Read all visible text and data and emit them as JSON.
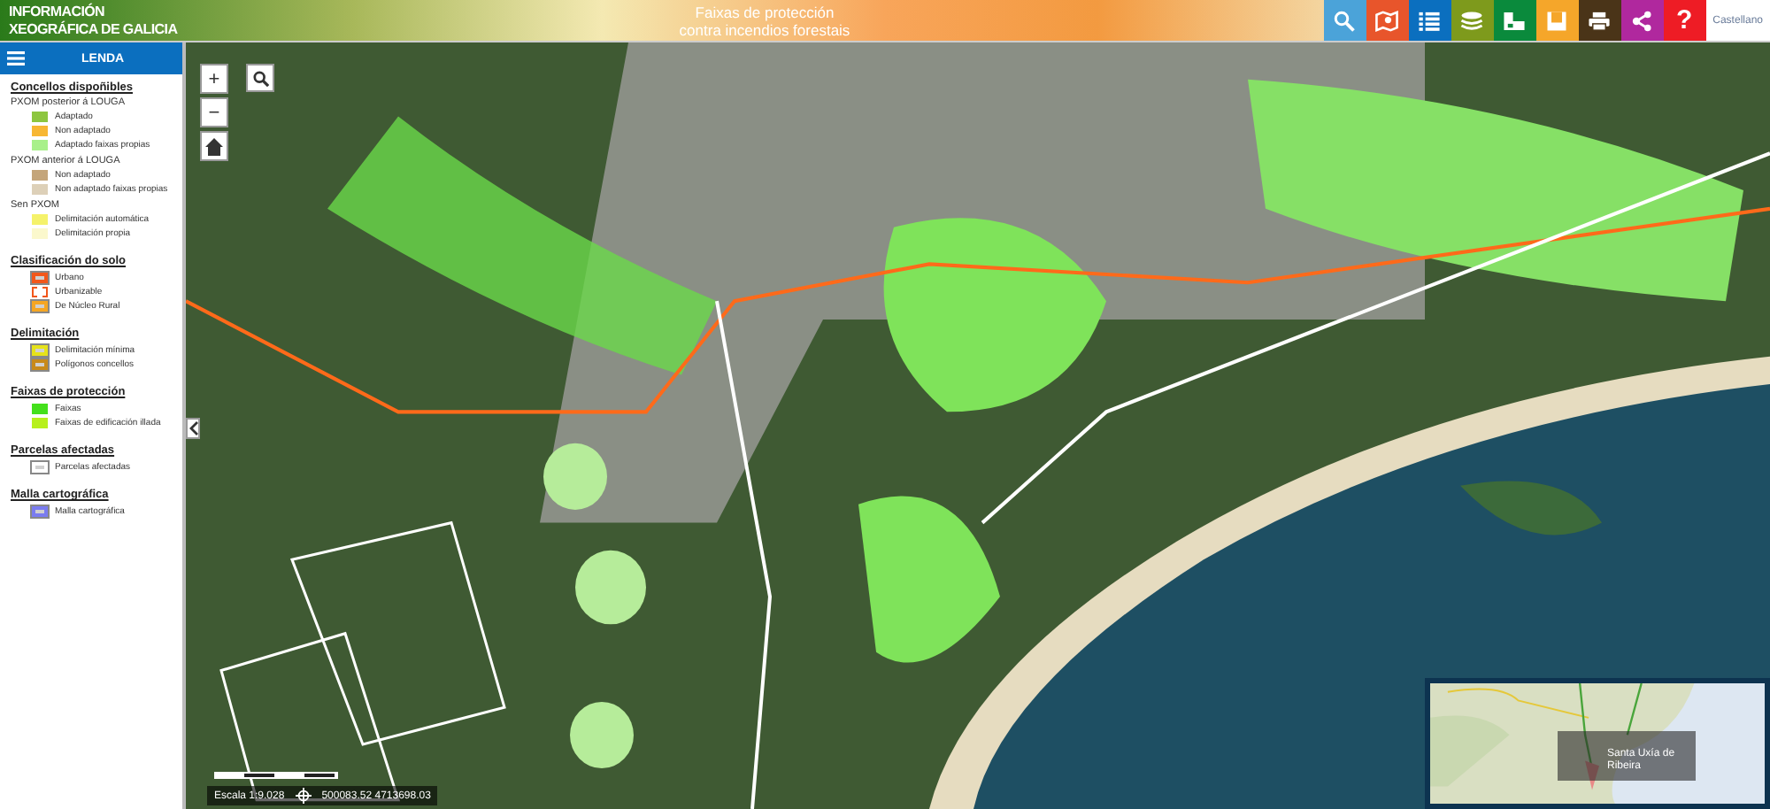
{
  "header": {
    "logo": [
      "INFORMACIÓN",
      "XEOGRÁFICA DE GALICIA"
    ],
    "title": [
      "Faixas de protección",
      "contra incendios forestais"
    ],
    "language": "Castellano"
  },
  "toolbar": [
    {
      "kind": "search",
      "color": "#4ba3d9"
    },
    {
      "kind": "map",
      "color": "#e8552b"
    },
    {
      "kind": "list",
      "color": "#0b6fbf"
    },
    {
      "kind": "layers",
      "color": "#7e9a1c"
    },
    {
      "kind": "legend",
      "color": "#0a8a3c"
    },
    {
      "kind": "save",
      "color": "#f5a62a"
    },
    {
      "kind": "print",
      "color": "#4a3418"
    },
    {
      "kind": "share",
      "color": "#b0289e"
    },
    {
      "kind": "help",
      "color": "#ee1c25",
      "label": "?"
    }
  ],
  "legend": {
    "title": "LENDA",
    "sections": [
      {
        "title": "Concellos dispoñibles",
        "groups": [
          {
            "subtitle": "PXOM posterior á LOUGA",
            "items": [
              {
                "label": "Adaptado",
                "kind": "fill",
                "color": "#8dc63f"
              },
              {
                "label": "Non adaptado",
                "kind": "fill",
                "color": "#f7b733"
              },
              {
                "label": "Adaptado faixas propias",
                "kind": "fill",
                "color": "#a8f08a"
              }
            ]
          },
          {
            "subtitle": "PXOM anterior á LOUGA",
            "items": [
              {
                "label": "Non adaptado",
                "kind": "fill",
                "color": "#c4a57a"
              },
              {
                "label": "Non adaptado faixas propias",
                "kind": "fill",
                "color": "#ddd0b8"
              }
            ]
          },
          {
            "subtitle": "Sen PXOM",
            "items": [
              {
                "label": "Delimitación automática",
                "kind": "fill",
                "color": "#f5f26a"
              },
              {
                "label": "Delimitación propia",
                "kind": "fill",
                "color": "#fbf8cc"
              }
            ]
          }
        ]
      },
      {
        "title": "Clasificación do solo",
        "groups": [
          {
            "items": [
              {
                "label": "Urbano",
                "kind": "outline",
                "color": "#f2571b"
              },
              {
                "label": "Urbanizable",
                "kind": "dashed",
                "color": "#f2571b"
              },
              {
                "label": "De Núcleo Rural",
                "kind": "outline",
                "color": "#f5a623"
              }
            ]
          }
        ]
      },
      {
        "title": "Delimitación",
        "groups": [
          {
            "items": [
              {
                "label": "Delimitación mínima",
                "kind": "outline",
                "color": "#e6e21a"
              },
              {
                "label": "Polígonos concellos",
                "kind": "outline",
                "color": "#c88a1a"
              }
            ]
          }
        ]
      },
      {
        "title": "Faixas de protección",
        "groups": [
          {
            "items": [
              {
                "label": "Faixas",
                "kind": "fill",
                "color": "#44e01c"
              },
              {
                "label": "Faixas de edificación illada",
                "kind": "fill",
                "color": "#b7f01c"
              }
            ]
          }
        ]
      },
      {
        "title": "Parcelas afectadas",
        "groups": [
          {
            "items": [
              {
                "label": "Parcelas afectadas",
                "kind": "outline",
                "color": "#ffffff"
              }
            ]
          }
        ]
      },
      {
        "title": "Malla cartográfica",
        "groups": [
          {
            "items": [
              {
                "label": "Malla cartográfica",
                "kind": "outline",
                "color": "#7a7cf0"
              }
            ]
          }
        ]
      }
    ]
  },
  "map": {
    "controls": [
      "+",
      "−"
    ],
    "scale": "Escala 1:9.028",
    "coordinates": "500083.52 4713698.03",
    "overview": {
      "place": "Santa Uxía de Ribeira"
    }
  }
}
